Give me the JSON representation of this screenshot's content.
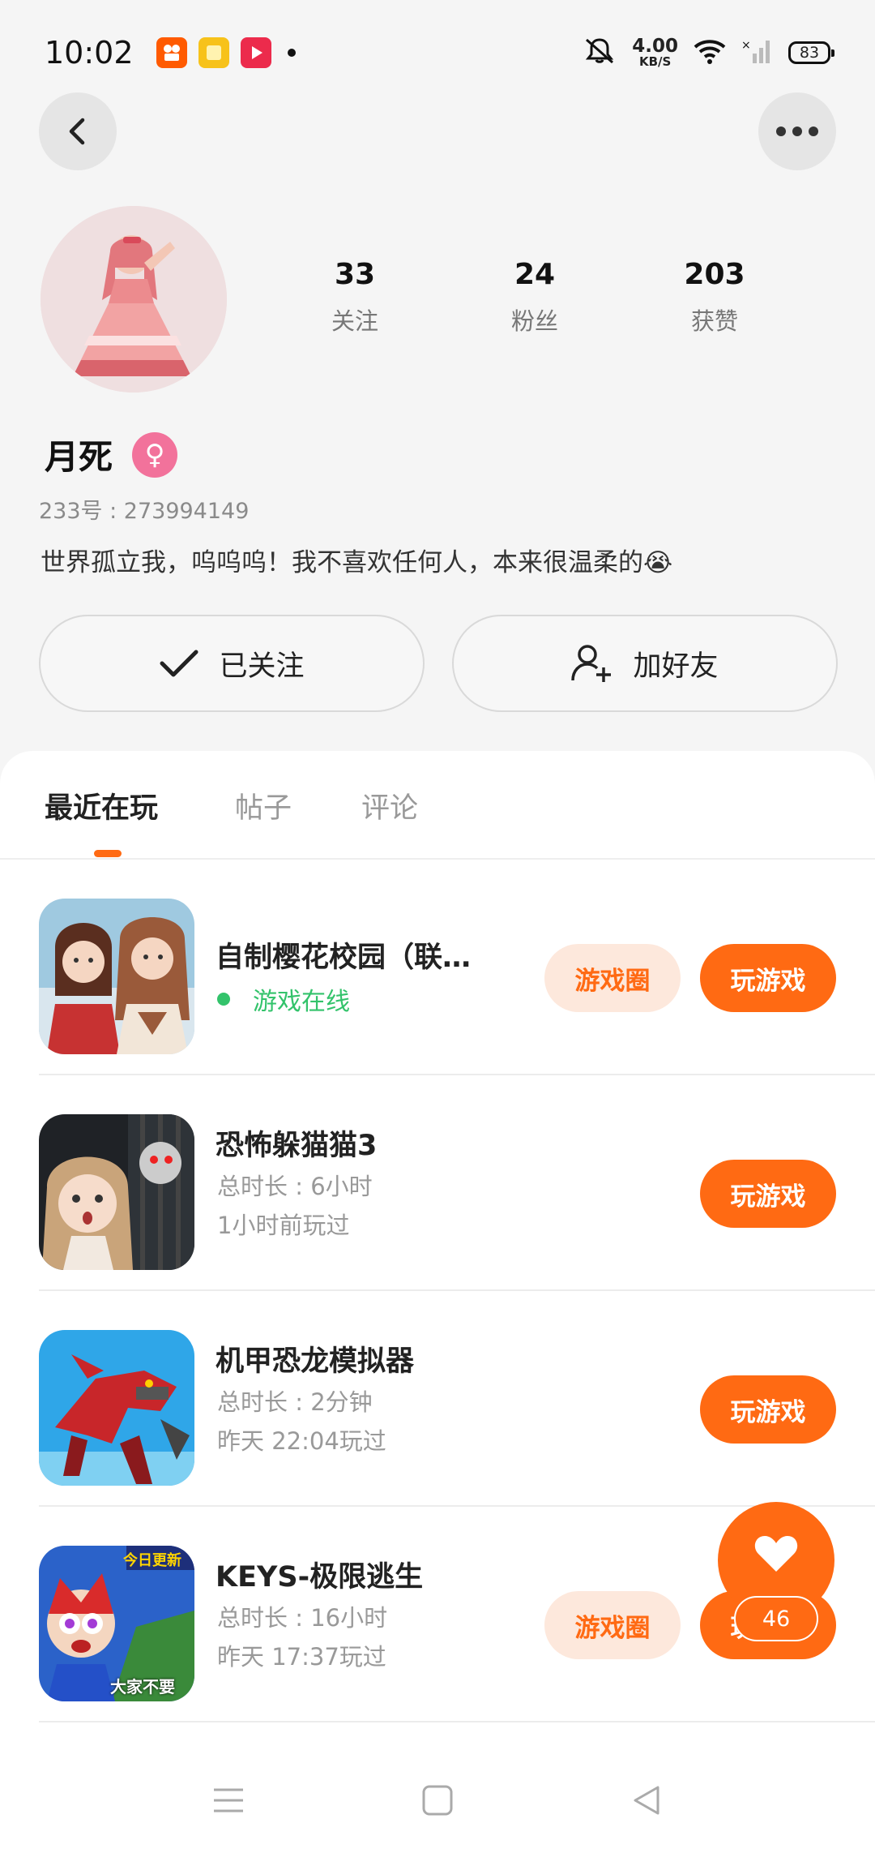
{
  "status_bar": {
    "time": "10:02",
    "net_speed_value": "4.00",
    "net_speed_unit": "KB/S",
    "battery": "83",
    "icons": [
      "kuaishou-app-icon",
      "notes-app-icon",
      "video-app-icon",
      "mute-bell-icon",
      "wifi-icon",
      "signal-icon"
    ]
  },
  "profile": {
    "stats": [
      {
        "value": "33",
        "label": "关注"
      },
      {
        "value": "24",
        "label": "粉丝"
      },
      {
        "value": "203",
        "label": "获赞"
      }
    ],
    "name": "月死",
    "gender_symbol": "♀",
    "id_text": "233号 : 273994149",
    "bio": "世界孤立我，呜呜呜！我不喜欢任何人，本来很温柔的😭",
    "follow_label": "已关注",
    "add_friend_label": "加好友"
  },
  "tabs": [
    {
      "label": "最近在玩",
      "active": true
    },
    {
      "label": "帖子",
      "active": false
    },
    {
      "label": "评论",
      "active": false
    }
  ],
  "games": [
    {
      "title": "自制樱花校园（联…",
      "status": "游戏在线",
      "circle_label": "游戏圈",
      "play_label": "玩游戏"
    },
    {
      "title": "恐怖躲猫猫3",
      "duration": "总时长 : 6小时",
      "last_played": "1小时前玩过",
      "play_label": "玩游戏"
    },
    {
      "title": "机甲恐龙模拟器",
      "duration": "总时长 : 2分钟",
      "last_played": "昨天 22:04玩过",
      "play_label": "玩游戏"
    },
    {
      "title": "KEYS-极限逃生",
      "duration": "总时长 : 16小时",
      "last_played": "昨天 17:37玩过",
      "circle_label": "游戏圈",
      "play_label": "玩游戏",
      "icon_text_top": "今日更新",
      "icon_text_bottom": "大家不要"
    }
  ],
  "like_fab": {
    "count": "46"
  },
  "colors": {
    "accent": "#ff6a13",
    "accent_light": "#fde8dc",
    "online_green": "#33c36b",
    "female_pink": "#f2729b"
  }
}
